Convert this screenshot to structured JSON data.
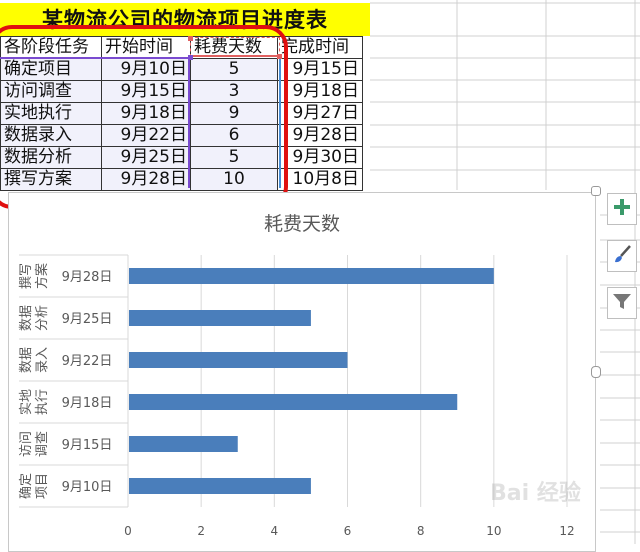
{
  "sheet": {
    "title": "某物流公司的物流项目进度表",
    "headers": [
      "各阶段任务",
      "开始时间",
      "耗费天数",
      "完成时间"
    ],
    "rows": [
      [
        "确定项目",
        "9月10日",
        "5",
        "9月15日"
      ],
      [
        "访问调查",
        "9月15日",
        "3",
        "9月18日"
      ],
      [
        "实地执行",
        "9月18日",
        "9",
        "9月27日"
      ],
      [
        "数据录入",
        "9月22日",
        "6",
        "9月28日"
      ],
      [
        "数据分析",
        "9月25日",
        "5",
        "9月30日"
      ],
      [
        "撰写方案",
        "9月28日",
        "10",
        "10月8日"
      ]
    ]
  },
  "chart_tools": {
    "add_element_icon": "plus-icon",
    "style_icon": "paintbrush-icon",
    "filter_icon": "filter-icon"
  },
  "colors": {
    "bar": "#4a7ebb",
    "highlight_outline": "#e01010",
    "title_fill": "#ffff00",
    "plus": "#3a9a6a"
  },
  "chart_data": {
    "type": "bar",
    "orientation": "horizontal",
    "title": "耗费天数",
    "categories": [
      {
        "task": "确定项目",
        "task_lines": [
          "确定",
          "项目"
        ],
        "date": "9月10日"
      },
      {
        "task": "访问调查",
        "task_lines": [
          "访问",
          "调查"
        ],
        "date": "9月15日"
      },
      {
        "task": "实地执行",
        "task_lines": [
          "实地",
          "执行"
        ],
        "date": "9月18日"
      },
      {
        "task": "数据录入",
        "task_lines": [
          "数据",
          "录入"
        ],
        "date": "9月22日"
      },
      {
        "task": "数据分析",
        "task_lines": [
          "数据",
          "分析"
        ],
        "date": "9月25日"
      },
      {
        "task": "撰写方案",
        "task_lines": [
          "撰写",
          "方案"
        ],
        "date": "9月28日"
      }
    ],
    "series": [
      {
        "name": "耗费天数",
        "values": [
          5,
          3,
          9,
          6,
          5,
          10
        ]
      }
    ],
    "xlim": [
      0,
      12
    ],
    "xticks": [
      0,
      2,
      4,
      6,
      8,
      10,
      12
    ],
    "grid": true,
    "legend": "none",
    "xlabel": "",
    "ylabel": ""
  },
  "watermark": "Bai 经验"
}
